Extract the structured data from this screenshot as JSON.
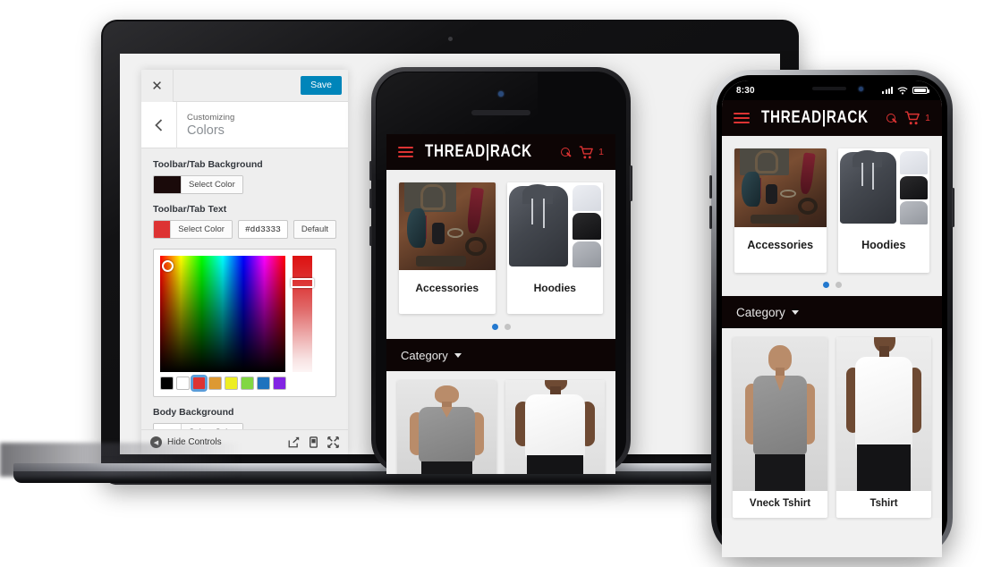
{
  "customizer": {
    "close_icon": "close-icon",
    "save_label": "Save",
    "back_icon": "chevron-left-icon",
    "eyebrow": "Customizing",
    "title": "Colors",
    "fields": [
      {
        "label": "Toolbar/Tab Background",
        "swatch_color": "#1a0a0a",
        "select_label": "Select Color",
        "has_hex": false,
        "hex": "",
        "default_label": ""
      },
      {
        "label": "Toolbar/Tab Text",
        "swatch_color": "#dd3333",
        "select_label": "Select Color",
        "has_hex": true,
        "hex": "#dd3333",
        "default_label": "Default"
      },
      {
        "label": "Body Background",
        "swatch_color": "#ffffff",
        "select_label": "Select Color",
        "has_hex": false,
        "hex": "",
        "default_label": ""
      }
    ],
    "picker": {
      "selected_hex": "#dd3333",
      "swatches": [
        "#000000",
        "#ffffff",
        "#dd3333",
        "#dd9933",
        "#eeee22",
        "#81d742",
        "#1e73be",
        "#8224e3"
      ],
      "selected_swatch_index": 2
    },
    "footer": {
      "hide_controls_label": "Hide Controls",
      "icons": [
        "share-icon",
        "mobile-preview-icon",
        "expand-icon"
      ]
    }
  },
  "app": {
    "brand": "THREAD|RACK",
    "menu_icon": "hamburger-icon",
    "search_icon": "search-icon",
    "cart_icon": "cart-icon",
    "cart_count": "1",
    "category_label": "Category",
    "featured": [
      {
        "label": "Accessories",
        "art": "img-acc"
      },
      {
        "label": "Hoodies",
        "art": "img-hood"
      }
    ],
    "pagination": {
      "total": 2,
      "active": 0
    },
    "products": [
      {
        "label": "Vneck Tshirt",
        "art": "img-tee-grey"
      },
      {
        "label": "Tshirt",
        "art": "img-tee-white"
      }
    ]
  },
  "phone_right": {
    "status": {
      "time": "8:30",
      "signal_icon": "signal-bars-icon",
      "wifi_icon": "wifi-icon",
      "battery_icon": "battery-icon"
    }
  },
  "colors": {
    "accent_red": "#dd3333",
    "toolbar_black": "#0d0505",
    "save_blue": "#0085ba",
    "dot_active": "#2479cf",
    "page_bg": "#efefef"
  }
}
